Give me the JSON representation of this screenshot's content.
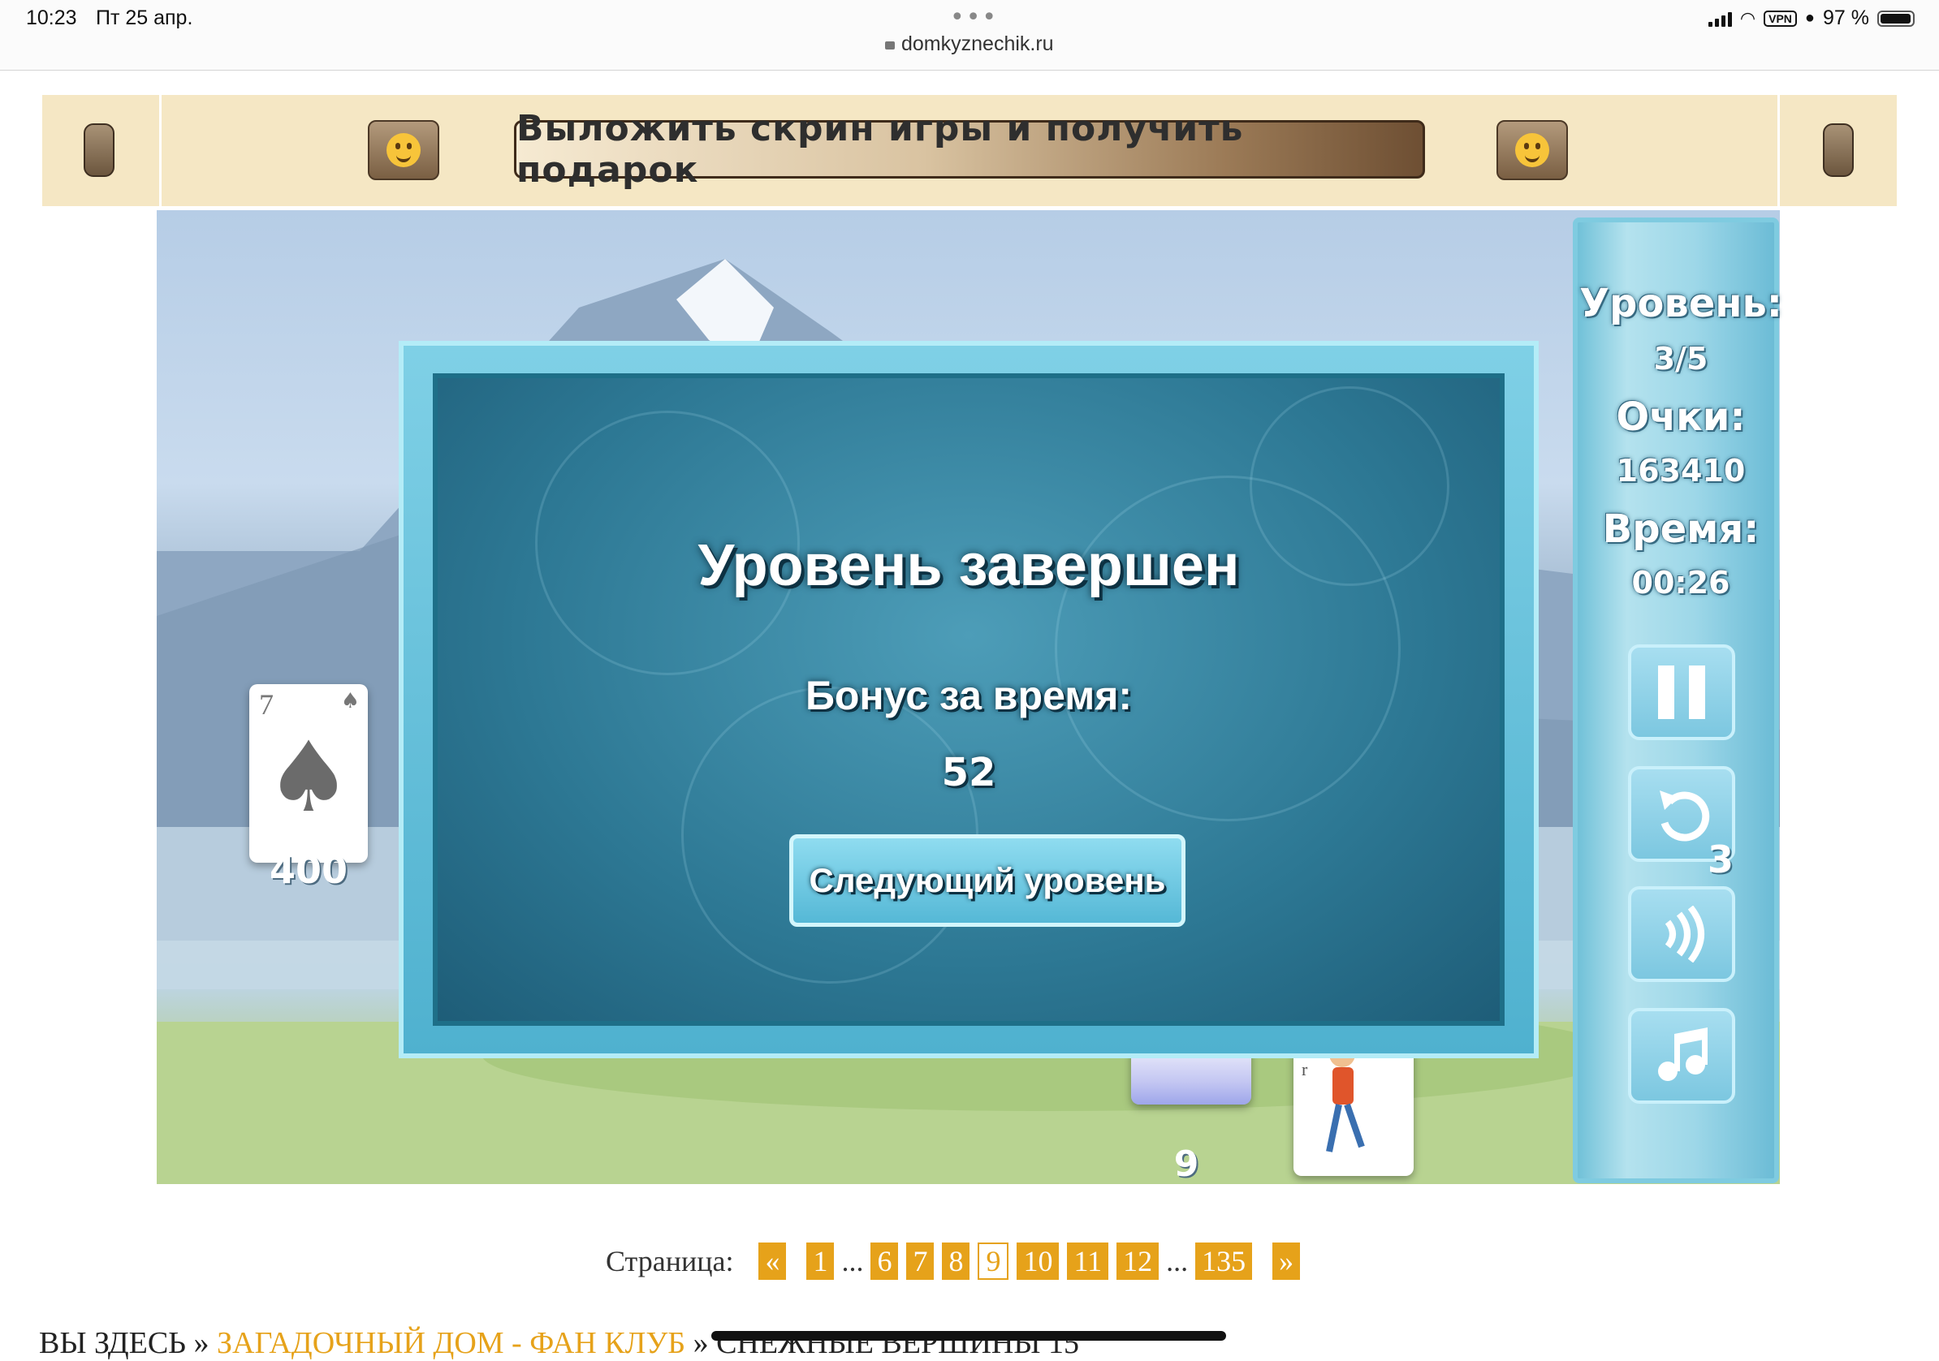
{
  "status_bar": {
    "time": "10:23",
    "date": "Пт 25 апр.",
    "url": "domkyznechik.ru",
    "vpn": "VPN",
    "battery": "97 %"
  },
  "banner": {
    "button_label": "Выложить скрин игры и получить подарок"
  },
  "game": {
    "sidebar": {
      "level_label": "Уровень:",
      "level_value": "3/5",
      "score_label": "Очки:",
      "score_value": "163410",
      "time_label": "Время:",
      "time_value": "00:26",
      "undo_count": "3"
    },
    "stock_card": {
      "rank": "7",
      "suit": "♠",
      "count": "400"
    },
    "waste_count": "9",
    "joker_text": "er",
    "dialog": {
      "title": "Уровень завершен",
      "bonus_label": "Бонус за время:",
      "bonus_value": "52",
      "next_button": "Следующий уровень"
    }
  },
  "pagination": {
    "label": "Страница:",
    "prev": "«",
    "next": "»",
    "pages": [
      "1",
      "6",
      "7",
      "8",
      "9",
      "10",
      "11",
      "12",
      "135"
    ],
    "current": "9",
    "ellipsis": "..."
  },
  "breadcrumb": {
    "prefix": "ВЫ ЗДЕСЬ »",
    "link": "ЗАГАДОЧНЫЙ ДОМ - ФАН КЛУБ",
    "sep": "»",
    "current": "СНЕЖНЫЕ ВЕРШИНЫ 15"
  },
  "colors": {
    "accent": "#e6a21a",
    "banner_bg": "#f5e7c4",
    "dialog_frame": "#7fd0e6",
    "dialog_inner": "#2d7894"
  }
}
